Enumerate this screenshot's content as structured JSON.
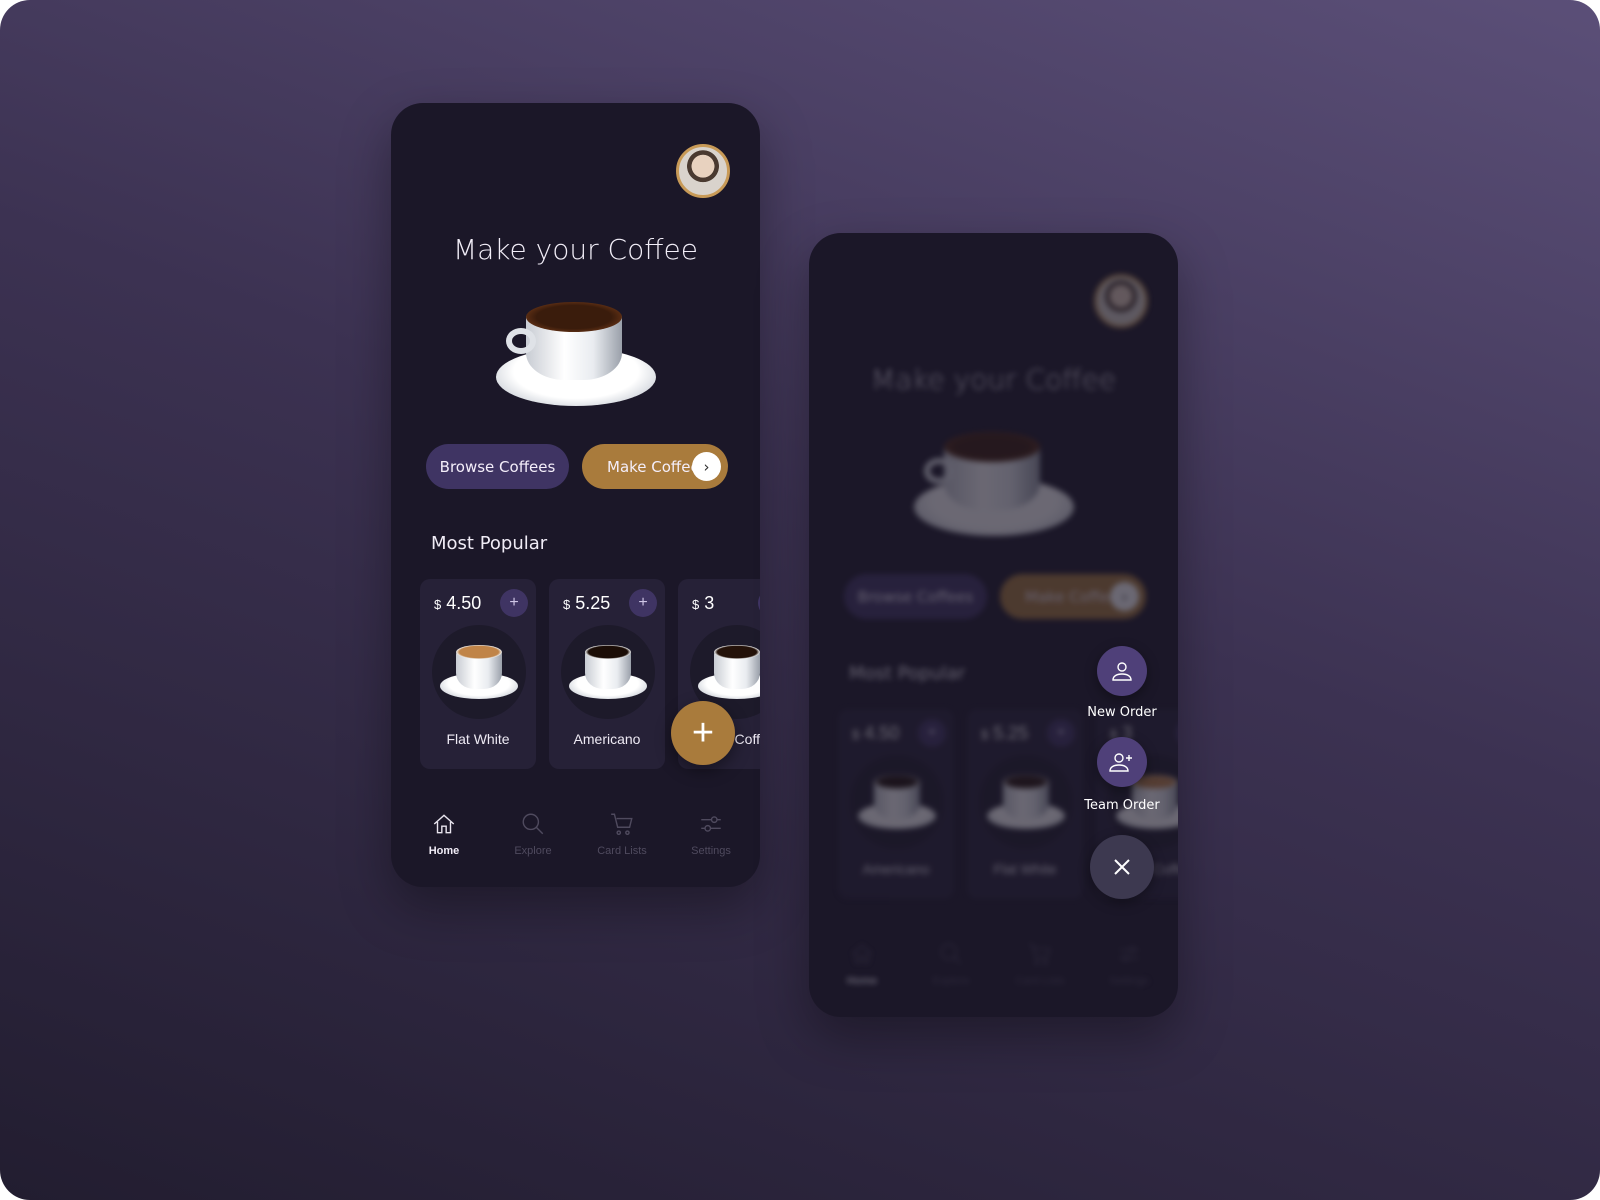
{
  "colors": {
    "accent": "#a97b3c",
    "primary": "#3f3463",
    "fab_menu": "#4f4079",
    "phone_bg": "#1b1728"
  },
  "screen1": {
    "title": "Make your Coffee",
    "buttons": {
      "browse": "Browse Coffees",
      "make": "Make Coffee"
    },
    "section": "Most Popular",
    "products": [
      {
        "currency": "$",
        "price": "4.50",
        "name": "Flat White"
      },
      {
        "currency": "$",
        "price": "5.25",
        "name": "Americano"
      },
      {
        "currency": "$",
        "price": "3",
        "name": "Black Coffee"
      }
    ],
    "nav": [
      {
        "label": "Home",
        "icon": "home-icon",
        "active": true
      },
      {
        "label": "Explore",
        "icon": "search-icon"
      },
      {
        "label": "Card Lists",
        "icon": "cart-icon"
      },
      {
        "label": "Settings",
        "icon": "sliders-icon"
      }
    ]
  },
  "screen2": {
    "title": "Make your Coffee",
    "buttons": {
      "browse": "Browse Coffees",
      "make": "Make Coffee"
    },
    "section": "Most Popular",
    "products": [
      {
        "currency": "$",
        "price": "4.50",
        "name": "Americano"
      },
      {
        "currency": "$",
        "price": "5.25",
        "name": "Flat White"
      },
      {
        "currency": "$",
        "price": "3",
        "name": "Black Coffee"
      }
    ],
    "nav": [
      {
        "label": "Home"
      },
      {
        "label": "Explore"
      },
      {
        "label": "Card Lists"
      },
      {
        "label": "Settings"
      }
    ],
    "fab_menu": {
      "new_order": "New Order",
      "team_order": "Team Order"
    }
  }
}
